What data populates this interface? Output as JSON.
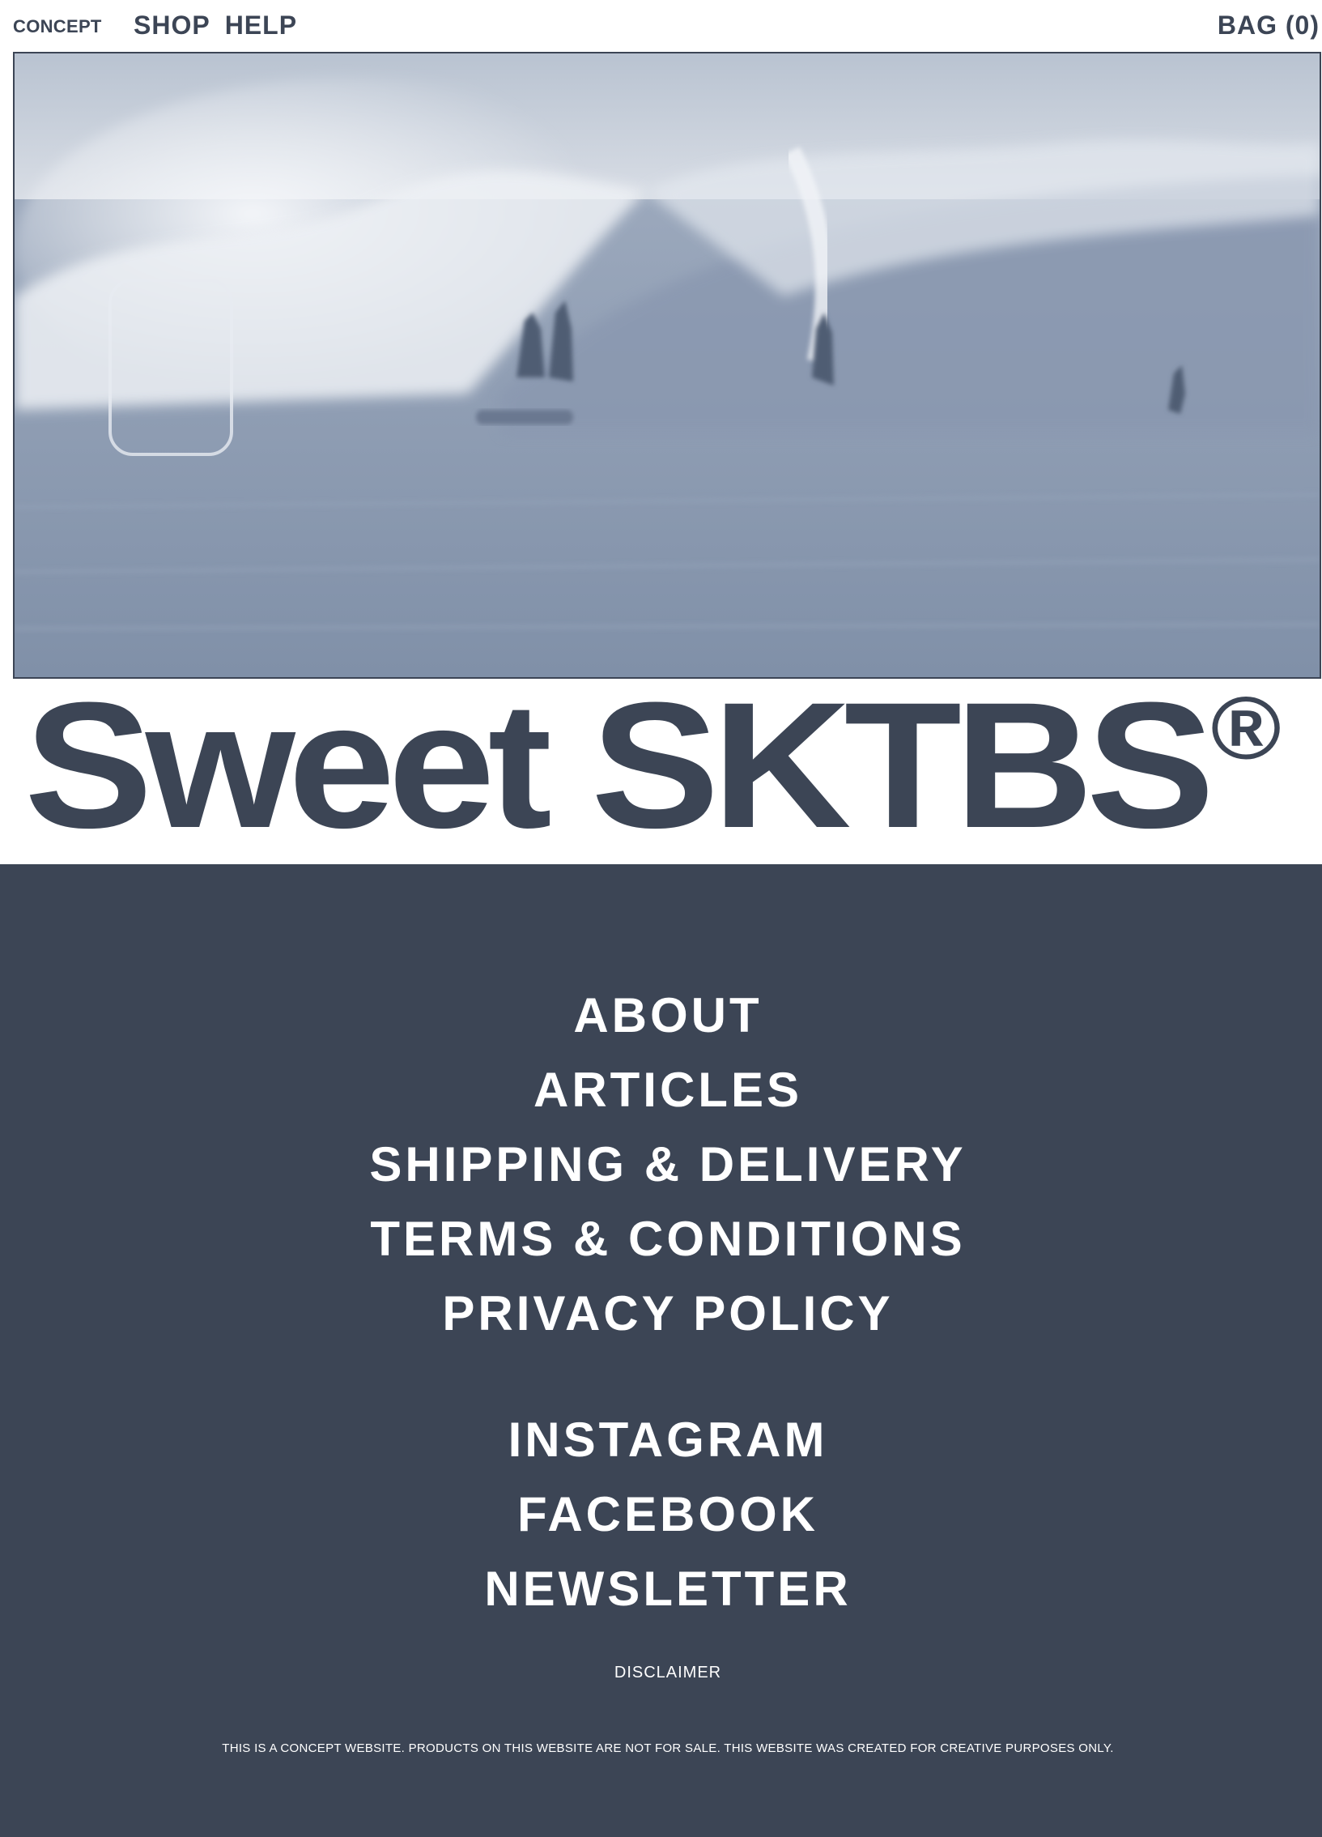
{
  "header": {
    "brand": "CONCEPT",
    "nav": [
      {
        "label": "SHOP"
      },
      {
        "label": "HELP"
      }
    ],
    "bag_label": "BAG (0)"
  },
  "hero": {
    "image_icon": "surf-wave-photo"
  },
  "wordmark": {
    "text": "Sweet SKTBS",
    "registered": "®"
  },
  "footer": {
    "links": [
      {
        "label": "ABOUT"
      },
      {
        "label": "ARTICLES"
      },
      {
        "label": "SHIPPING & DELIVERY"
      },
      {
        "label": "TERMS & CONDITIONS"
      },
      {
        "label": "PRIVACY POLICY"
      }
    ],
    "social": [
      {
        "label": "INSTAGRAM"
      },
      {
        "label": "FACEBOOK"
      },
      {
        "label": "NEWSLETTER"
      }
    ],
    "disclaimer": "DISCLAIMER",
    "notice": "THIS IS A CONCEPT WEBSITE. PRODUCTS ON THIS WEBSITE ARE NOT FOR SALE. THIS WEBSITE WAS CREATED FOR CREATIVE PURPOSES ONLY."
  },
  "colors": {
    "primary": "#3c4555",
    "background": "#ffffff",
    "footer_text": "#ffffff"
  }
}
